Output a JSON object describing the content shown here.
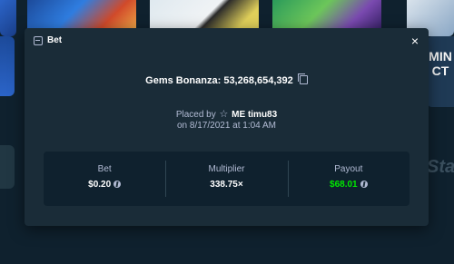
{
  "modal": {
    "title": "Bet",
    "close_symbol": "×",
    "header_icon": "bet-slip-icon",
    "game_label": "Gems Bonanza: 53,268,654,392",
    "copy_icon": "copy-icon",
    "placed_by_prefix": "Placed by",
    "user_icon": "star-icon",
    "user_name": "ME timu83",
    "date": "on 8/17/2021 at 1:04 AM",
    "stats": {
      "bet_label": "Bet",
      "bet_value": "$0.20",
      "multiplier_label": "Multiplier",
      "multiplier_value": "338.75×",
      "payout_label": "Payout",
      "payout_value": "$68.01",
      "currency_icon": "coin-icon"
    }
  },
  "background": {
    "right_peek_text": "MIN\nCT",
    "right_peek2_text": "Sta"
  },
  "colors": {
    "page_bg": "#0f212e",
    "modal_bg": "#1a2c38",
    "muted_text": "#b1bad3",
    "win_green": "#00e701"
  }
}
